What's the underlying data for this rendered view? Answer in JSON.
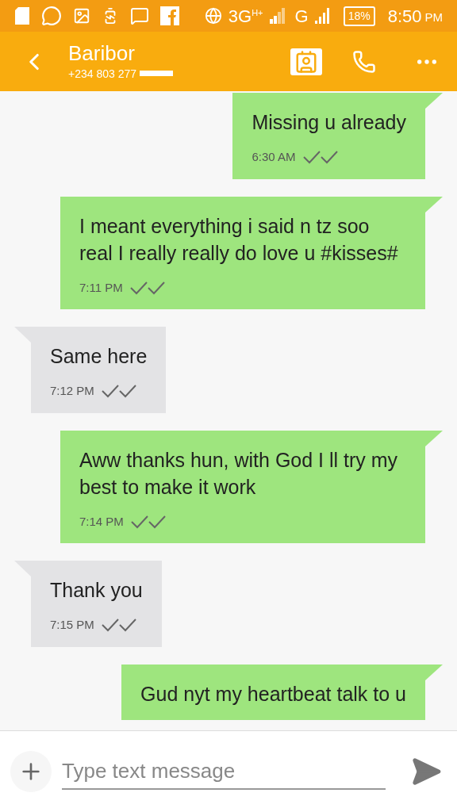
{
  "status_bar": {
    "network": "3G",
    "network_sub": "H+",
    "network2": "G",
    "battery": "18%",
    "time": "8:50",
    "period": "PM"
  },
  "header": {
    "title": "Baribor",
    "subtitle": "+234 803 277"
  },
  "messages": [
    {
      "kind": "sent",
      "text": "Missing u already",
      "time": "6:30 AM",
      "read": true
    },
    {
      "kind": "sent",
      "text": "I meant everything i said n tz soo real I really really do love u #kisses#",
      "time": "7:11 PM",
      "read": true
    },
    {
      "kind": "received",
      "text": "Same here",
      "time": "7:12 PM",
      "read": true
    },
    {
      "kind": "sent",
      "text": "Aww thanks hun, with God I ll try my best to make it work",
      "time": "7:14 PM",
      "read": true
    },
    {
      "kind": "received",
      "text": "Thank you",
      "time": "7:15 PM",
      "read": true
    },
    {
      "kind": "sent",
      "text": "Gud nyt my heartbeat talk to u"
    }
  ],
  "composer": {
    "placeholder": "Type text message"
  }
}
